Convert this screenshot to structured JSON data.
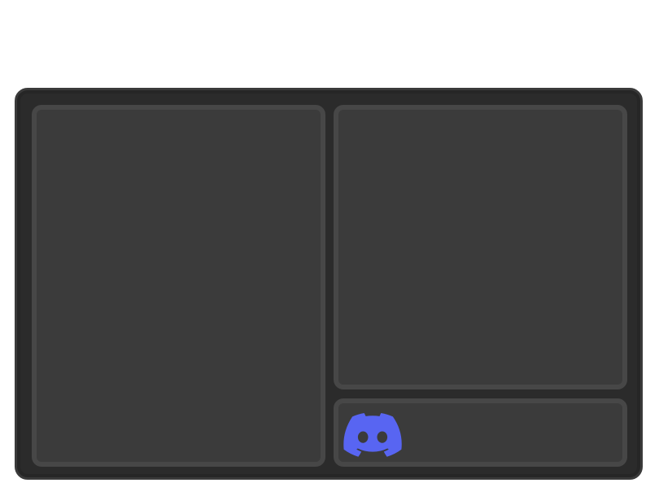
{
  "window": {
    "background": "#2b2b2b",
    "border": "#3a3a3a"
  },
  "panels": {
    "fill": "#3b3b3b",
    "border": "#474747",
    "left": {},
    "right_top": {},
    "right_bottom": {
      "icon": "discord-logo-icon",
      "icon_color": "#5865F2"
    }
  }
}
